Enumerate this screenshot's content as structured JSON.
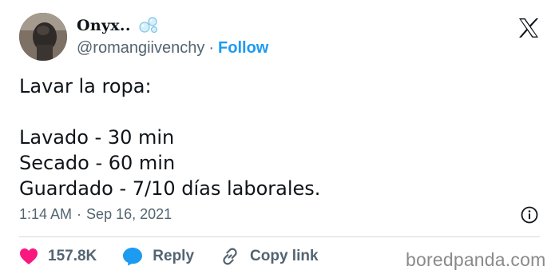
{
  "author": {
    "display_name": "Onyx..",
    "handle": "@romangiivenchy",
    "separator": "·",
    "follow_label": "Follow"
  },
  "tweet": {
    "lines": [
      "Lavar la ropa:",
      "",
      "Lavado - 30 min",
      "Secado - 60 min",
      "Guardado - 7/10 días laborales."
    ]
  },
  "meta": {
    "time": "1:14 AM",
    "separator": "·",
    "date": "Sep 16, 2021"
  },
  "actions": {
    "likes_count": "157.8K",
    "reply_label": "Reply",
    "copy_link_label": "Copy link"
  },
  "watermark": "boredpanda.com",
  "colors": {
    "link_blue": "#1d9bf0",
    "heart_pink": "#f91880",
    "muted_gray": "#536471",
    "text_dark": "#0f1419"
  }
}
